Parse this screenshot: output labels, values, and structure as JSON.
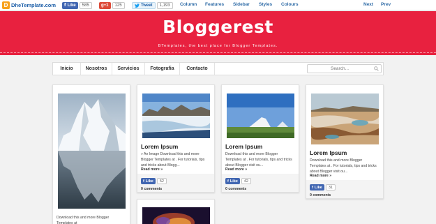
{
  "topbar": {
    "brand_logo_letter": "D",
    "brand_name": "DheTemplate.com",
    "facebook": {
      "label": "Like",
      "count": "585"
    },
    "gplus": {
      "label": "g+1",
      "count": "125"
    },
    "twitter": {
      "label": "Tweet",
      "count": "1,193"
    },
    "nav": [
      "Column",
      "Features",
      "Sidebar",
      "Styles",
      "Colours"
    ],
    "next_label": "Next",
    "prev_label": "Prev"
  },
  "header": {
    "title": "Bloggerest",
    "description": "BTemplates, the best place for Blogger Templates."
  },
  "menu": {
    "items": [
      "Inicio",
      "Nosotros",
      "Servicios",
      "Fotografia",
      "Contacto"
    ],
    "search_placeholder": "Search..."
  },
  "posts": [
    {
      "image": "iceberg-reflection",
      "excerpt": "Download this and more Blogger Templates at"
    },
    {
      "image": "glacier-landscape",
      "title": "Lorem Ipsum",
      "excerpt": "» An Image Download this and more Blogger Templates at . For tutorials, tips and tricks about Blogg...",
      "read_more": "Read more »",
      "like_label": "Like",
      "like_count": "52",
      "comments": "0 comments"
    },
    {
      "image": "volcano-field",
      "title": "Lorem Ipsum",
      "excerpt": "Download this and more Blogger Templates at . For tutorials, tips and tricks about Blogger visit ou...",
      "read_more": "Read more »",
      "like_label": "Like",
      "like_count": "42",
      "comments": "0 comments"
    },
    {
      "image": "hot-springs-terraces",
      "title": "Lorem Ipsum",
      "excerpt": "Download this and more Blogger Templates at . For tutorials, tips and tricks about Blogger visit ou...",
      "read_more": "Read more »",
      "like_label": "Like",
      "like_count": "31",
      "comments": "0 comments"
    },
    {
      "image": "nebula"
    }
  ],
  "colors": {
    "header_red": "#e8213f",
    "link_blue": "#2d6aa6",
    "facebook_blue": "#4267b2",
    "page_bg": "#f2f2f2"
  }
}
